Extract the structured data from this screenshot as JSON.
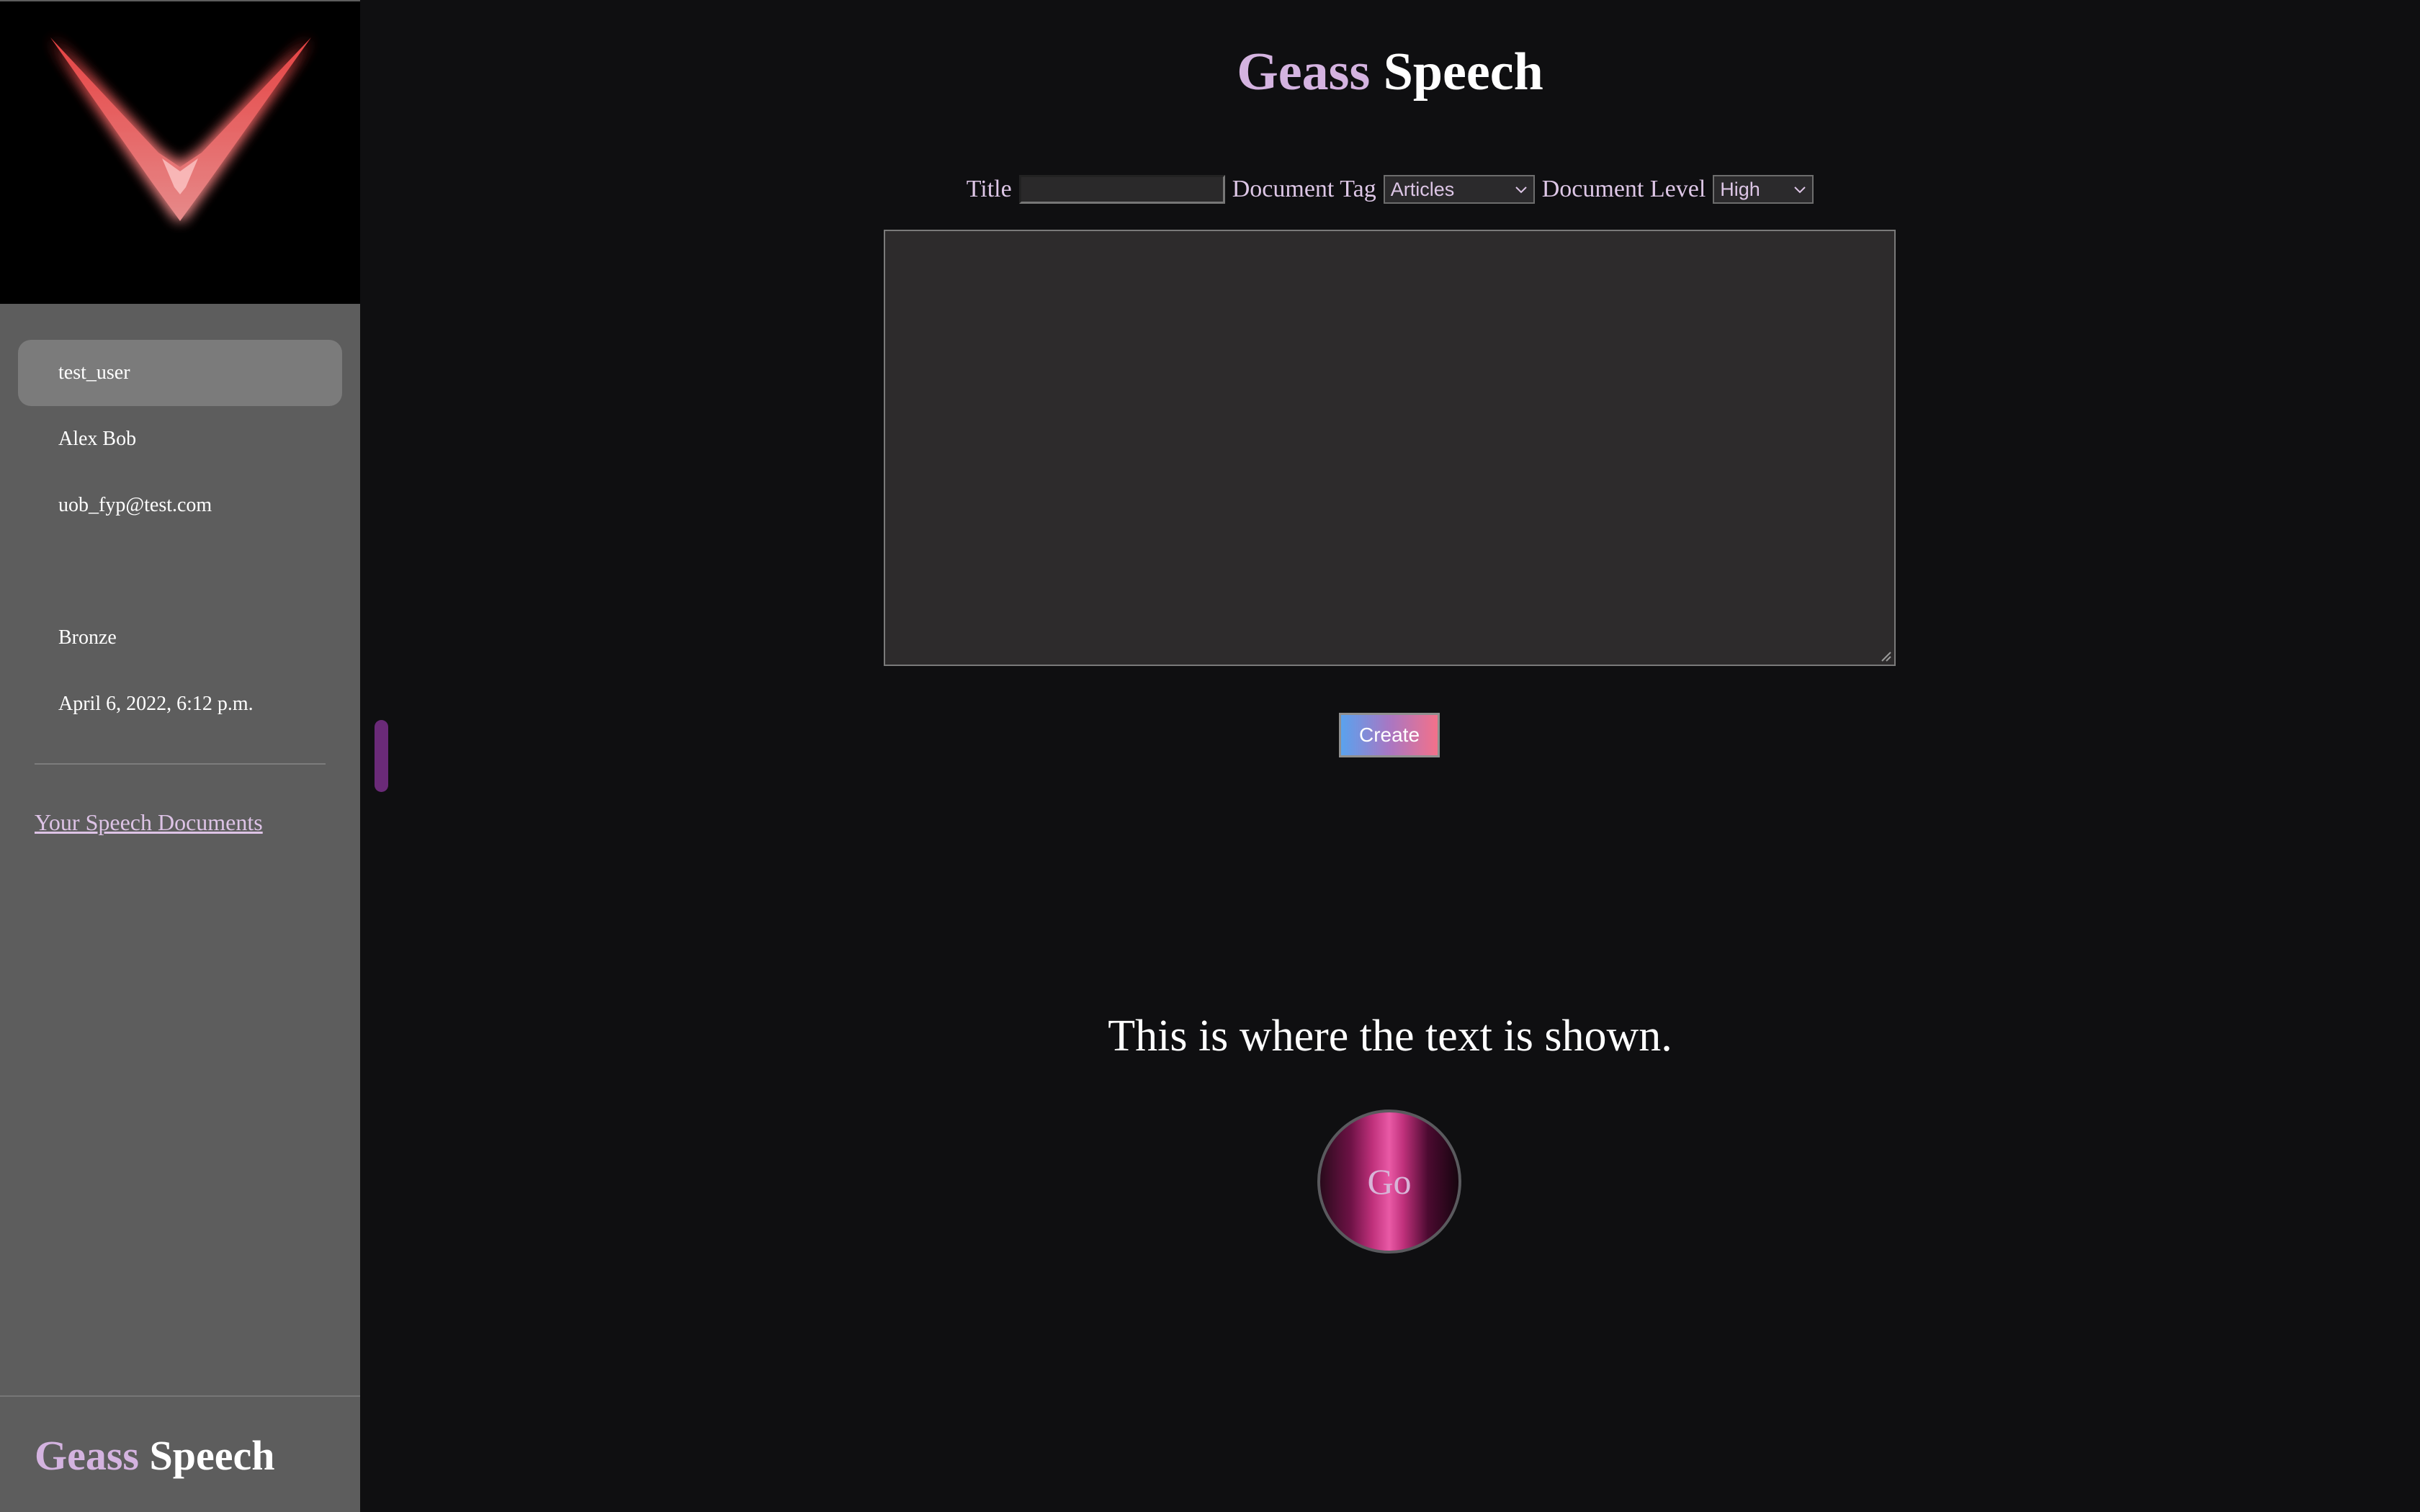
{
  "brand": {
    "part1": "Geass",
    "part2": "Speech"
  },
  "sidebar": {
    "profile": [
      "test_user",
      "Alex Bob",
      "uob_fyp@test.com",
      "",
      "Bronze",
      "April 6, 2022, 6:12 p.m."
    ],
    "docs_link": "Your Speech Documents"
  },
  "form": {
    "title_label": "Title",
    "title_value": "",
    "tag_label": "Document Tag",
    "tag_selected": "Articles",
    "level_label": "Document Level",
    "level_selected": "High",
    "body_value": "",
    "create_label": "Create"
  },
  "output": {
    "text": "This is where the text is shown.",
    "go_label": "Go"
  },
  "colors": {
    "brand_accent": "#d4b3e0",
    "sidebar_bg": "#5d5d5d",
    "page_bg": "#0f0f11",
    "link": "#ddc3e6"
  }
}
